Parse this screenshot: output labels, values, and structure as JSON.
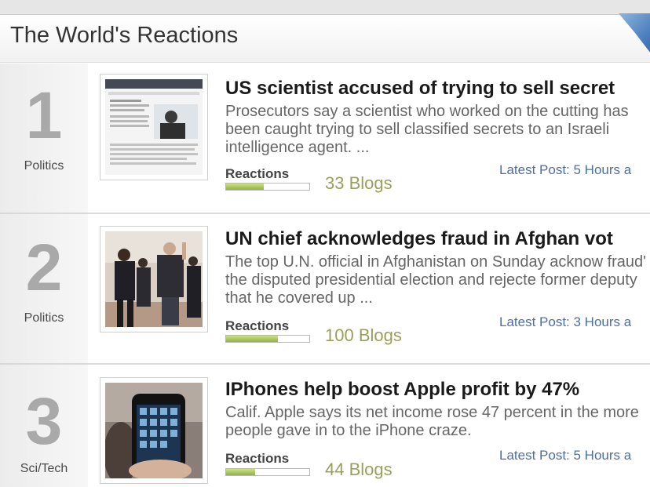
{
  "header": {
    "title": "The World's Reactions"
  },
  "items": [
    {
      "rank": "1",
      "category": "Politics",
      "headline": "US scientist accused of trying to sell secret",
      "summary": "Prosecutors say a scientist who worked on the cutting has been caught trying to sell classified secrets to an Israeli intelligence agent. ...",
      "reactions_label": "Reactions",
      "reaction_fraction": 0.45,
      "blogs": "33 Blogs",
      "latest": "Latest Post: 5 Hours a"
    },
    {
      "rank": "2",
      "category": "Politics",
      "headline": "UN chief acknowledges fraud in Afghan vot",
      "summary": "The top U.N. official in Afghanistan on Sunday acknow fraud' in the disputed presidential election and rejecte former deputy that he covered up ...",
      "reactions_label": "Reactions",
      "reaction_fraction": 0.62,
      "blogs": "100 Blogs",
      "latest": "Latest Post: 3 Hours a"
    },
    {
      "rank": "3",
      "category": "Sci/Tech",
      "headline": "IPhones help boost Apple profit by 47%",
      "summary": "Calif. Apple says its net income rose 47 percent in the more people gave in to the iPhone craze.",
      "reactions_label": "Reactions",
      "reaction_fraction": 0.35,
      "blogs": "44 Blogs",
      "latest": "Latest Post: 5 Hours a"
    }
  ]
}
